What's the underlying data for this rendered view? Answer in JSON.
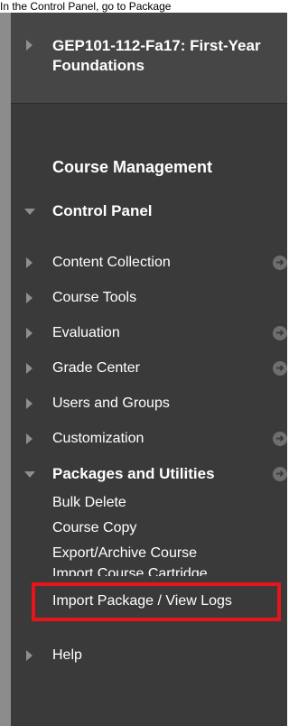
{
  "caption": "In the Control Panel, go to Package",
  "course": {
    "title": "GEP101-112-Fa17: First-Year Foundations"
  },
  "section_heading": "Course Management",
  "control_panel": {
    "label": "Control Panel"
  },
  "menu": [
    {
      "label": "Content Collection",
      "has_menu": true
    },
    {
      "label": "Course Tools",
      "has_menu": false
    },
    {
      "label": "Evaluation",
      "has_menu": true
    },
    {
      "label": "Grade Center",
      "has_menu": true
    },
    {
      "label": "Users and Groups",
      "has_menu": false
    },
    {
      "label": "Customization",
      "has_menu": true
    }
  ],
  "packages": {
    "label": "Packages and Utilities",
    "items": [
      {
        "label": "Bulk Delete"
      },
      {
        "label": "Course Copy"
      },
      {
        "label": "Export/Archive Course"
      },
      {
        "label": "Import Course Cartridge"
      },
      {
        "label": "Import Package / View Logs"
      }
    ]
  },
  "help": {
    "label": "Help"
  },
  "colors": {
    "panel_bg": "#3a3a3a",
    "highlight": "#e8141c"
  },
  "icons": {
    "collapsed": "triangle-right-icon",
    "expanded": "triangle-down-icon",
    "menu": "circle-arrow-icon"
  }
}
